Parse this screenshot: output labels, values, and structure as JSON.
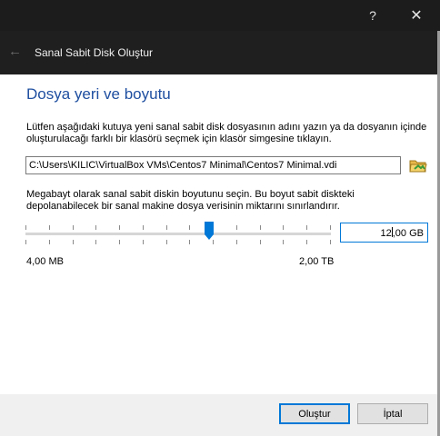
{
  "window": {
    "help_glyph": "?",
    "close_glyph": "✕"
  },
  "header": {
    "back_glyph": "←",
    "title": "Sanal Sabit Disk Oluştur"
  },
  "section": {
    "title": "Dosya yeri ve boyutu"
  },
  "location": {
    "description": "Lütfen aşağıdaki kutuya yeni sanal sabit disk dosyasının adını yazın ya da dosyanın içinde oluşturulacağı farklı bir klasörü seçmek için klasör simgesine tıklayın.",
    "path_value": "C:\\Users\\KILIC\\VirtualBox VMs\\Centos7 Minimal\\Centos7 Minimal.vdi",
    "folder_icon": "folder-icon"
  },
  "size": {
    "description": "Megabayt olarak sanal sabit diskin boyutunu seçin. Bu boyut sabit diskteki depolanabilecek bir sanal makine dosya verisinin miktarını sınırlandırır.",
    "value_before_caret": "12",
    "value_after_caret": ",00 GB",
    "slider_fraction": 0.6,
    "min_label": "4,00 MB",
    "max_label": "2,00 TB"
  },
  "buttons": {
    "create": "Oluştur",
    "cancel": "İptal"
  },
  "colors": {
    "accent": "#0078d7",
    "title_text": "#1f4fa0",
    "dark_header": "#1f1f1f"
  }
}
